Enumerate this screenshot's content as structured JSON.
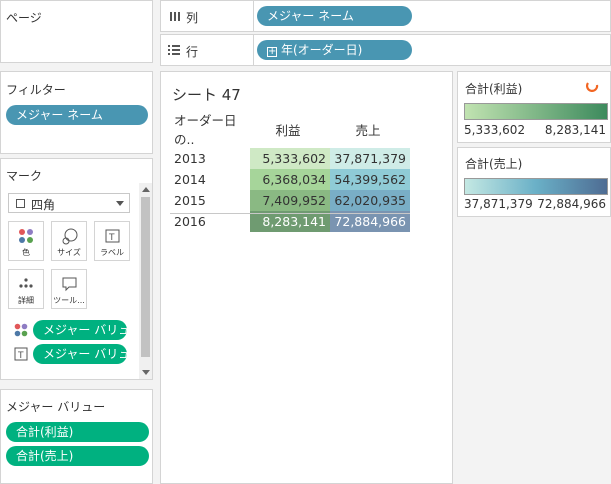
{
  "pages": {
    "title": "ページ"
  },
  "shelves": {
    "columns": {
      "label": "列",
      "pill": "メジャー ネーム"
    },
    "rows": {
      "label": "行",
      "pill": "年(オーダー日)"
    }
  },
  "filters": {
    "title": "フィルター",
    "pill": "メジャー ネーム"
  },
  "marks": {
    "title": "マーク",
    "mark_type": "四角",
    "buttons": {
      "color": "色",
      "size": "サイズ",
      "label": "ラベル",
      "detail": "詳細",
      "tooltip": "ツール..."
    },
    "fields": [
      {
        "pill": "メジャー バリュ..."
      },
      {
        "pill": "メジャー バリュ..."
      }
    ]
  },
  "measure_values": {
    "title": "メジャー バリュー",
    "pills": [
      "合計(利益)",
      "合計(売上)"
    ]
  },
  "sheet": {
    "title": "シート 47",
    "row_header": "オーダー日 の..",
    "columns": [
      "利益",
      "売上"
    ],
    "rows": [
      {
        "year": "2013",
        "profit": "5,333,602",
        "sales": "37,871,379"
      },
      {
        "year": "2014",
        "profit": "6,368,034",
        "sales": "54,399,562"
      },
      {
        "year": "2015",
        "profit": "7,409,952",
        "sales": "62,020,935"
      },
      {
        "year": "2016",
        "profit": "8,283,141",
        "sales": "72,884,966"
      }
    ]
  },
  "legends": {
    "profit": {
      "title": "合計(利益)",
      "min": "5,333,602",
      "max": "8,283,141"
    },
    "sales": {
      "title": "合計(売上)",
      "min": "37,871,379",
      "max": "72,884,966"
    }
  },
  "colors": {
    "profit_cells": [
      "#cfe9c5",
      "#a6d59a",
      "#8ab983",
      "#6f9b71"
    ],
    "sales_cells": [
      "#cfece7",
      "#8fcbd6",
      "#79aec6",
      "#7a94b1"
    ],
    "pill_blue": "#4996b2",
    "pill_green": "#00b180",
    "accent_orange": "#f26522"
  }
}
